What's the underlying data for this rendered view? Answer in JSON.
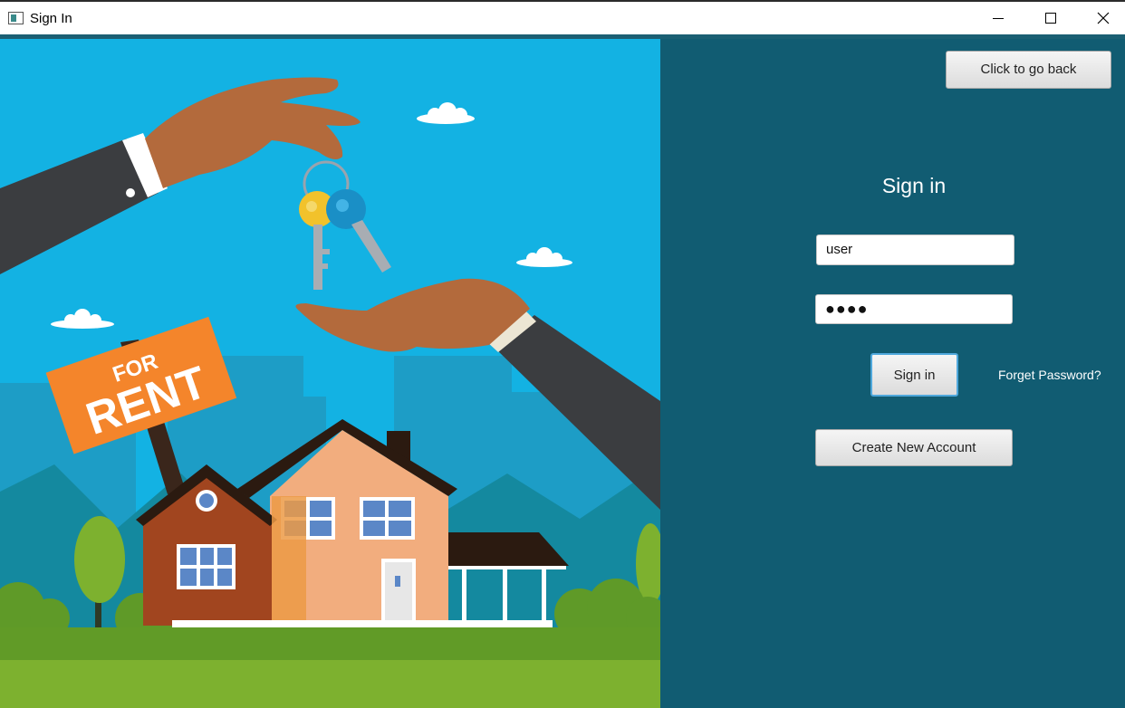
{
  "window": {
    "title": "Sign In",
    "icon": "app-window-icon",
    "controls": [
      "minimize-icon",
      "maximize-icon",
      "close-icon"
    ]
  },
  "illustration": {
    "sign_top": "FOR",
    "sign_bottom": "RENT"
  },
  "panel": {
    "back_label": "Click to go back",
    "heading": "Sign in",
    "username_value": "user",
    "password_value": "●●●●",
    "signin_label": "Sign in",
    "forget_label": "Forget Password?",
    "create_label": "Create New Account"
  },
  "colors": {
    "panel_bg": "#115c72",
    "sky": "#13b2e3",
    "grass": "#7db12f",
    "sign": "#f4852b"
  }
}
